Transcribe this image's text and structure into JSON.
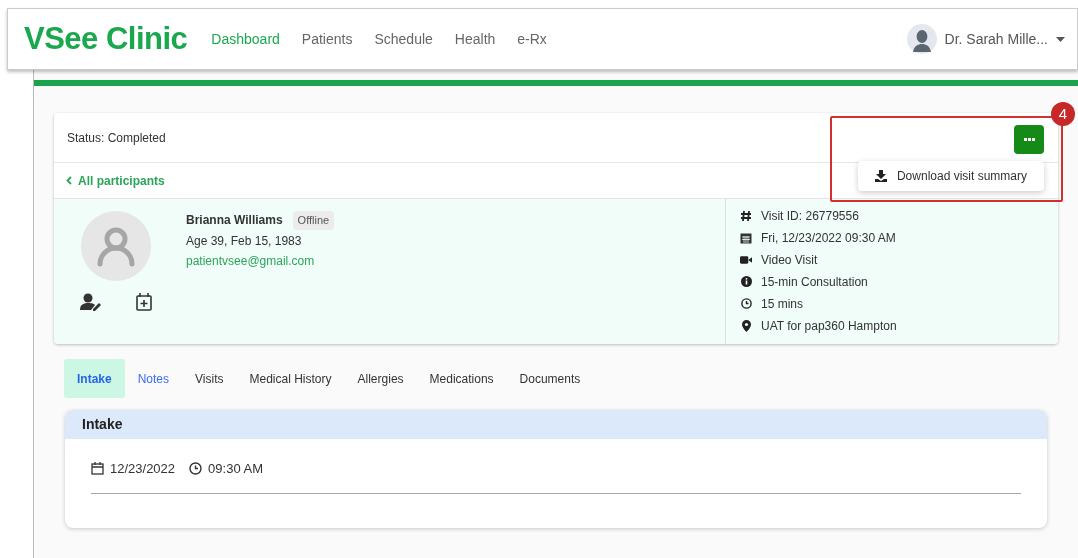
{
  "header": {
    "logo": "VSee Clinic",
    "nav": [
      {
        "label": "Dashboard",
        "selected": true
      },
      {
        "label": "Patients",
        "selected": false
      },
      {
        "label": "Schedule",
        "selected": false
      },
      {
        "label": "Health",
        "selected": false
      },
      {
        "label": "e-Rx",
        "selected": false
      }
    ],
    "user": "Dr. Sarah Mille..."
  },
  "visit": {
    "status": "Status: Completed",
    "menu": {
      "open": true,
      "items": [
        "Download visit summary"
      ]
    },
    "callout": "4",
    "back_link": "All participants",
    "patient": {
      "name": "Brianna Williams",
      "presence": "Offline",
      "age": "Age 39, Feb 15, 1983",
      "email": "patientvsee@gmail.com"
    },
    "details": [
      {
        "kind": "hash",
        "text": "Visit ID: 26779556"
      },
      {
        "kind": "calendar",
        "text": "Fri, 12/23/2022 09:30 AM"
      },
      {
        "kind": "video",
        "text": "Video Visit"
      },
      {
        "kind": "info",
        "text": "15-min Consultation"
      },
      {
        "kind": "clock",
        "text": "15 mins"
      },
      {
        "kind": "pin",
        "text": "UAT for pap360 Hampton"
      }
    ]
  },
  "tabs": [
    {
      "label": "Intake",
      "selected": true,
      "hovered": false
    },
    {
      "label": "Notes",
      "selected": false,
      "hovered": true
    },
    {
      "label": "Visits",
      "selected": false,
      "hovered": false
    },
    {
      "label": "Medical History",
      "selected": false,
      "hovered": false
    },
    {
      "label": "Allergies",
      "selected": false,
      "hovered": false
    },
    {
      "label": "Medications",
      "selected": false,
      "hovered": false
    },
    {
      "label": "Documents",
      "selected": false,
      "hovered": false
    }
  ],
  "intake": {
    "title": "Intake",
    "date": "12/23/2022",
    "time": "09:30 AM"
  }
}
